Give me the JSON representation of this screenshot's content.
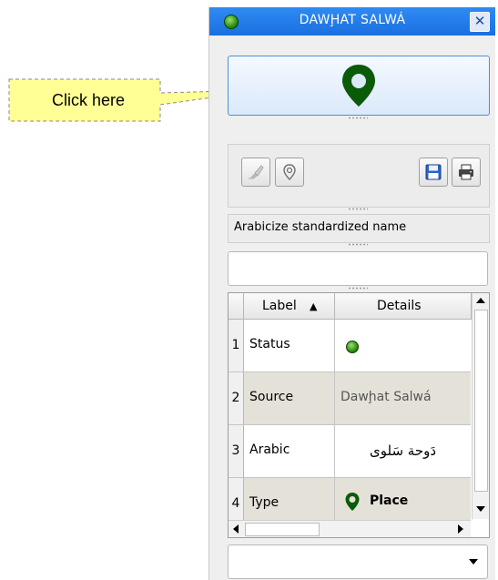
{
  "callout": {
    "text": "Click here"
  },
  "window": {
    "title": "DAWḨAT SALWÁ",
    "close_label": "✕",
    "status_color": "#2f8f12"
  },
  "toolbar": {
    "buttons": [
      "brush-icon",
      "pin-outline-icon",
      "save-icon",
      "print-icon"
    ]
  },
  "name_field": {
    "label": "Arabicize standardized name"
  },
  "text_field": {
    "value": ""
  },
  "table": {
    "columns": [
      "Label",
      "Details"
    ],
    "sort_indicator": "▲",
    "rows": [
      {
        "num": "1",
        "label": "Status",
        "detail": ""
      },
      {
        "num": "2",
        "label": "Source",
        "detail": "Dawḩat Salwá"
      },
      {
        "num": "3",
        "label": "Arabic",
        "detail": "دَوحة سَلوى"
      },
      {
        "num": "4",
        "label": "Type",
        "detail": "Place"
      }
    ]
  },
  "dropdown": {
    "value": ""
  },
  "colors": {
    "accent": "#1a6fe0",
    "pin": "#0a5a0a",
    "alt_row": "#e4e1d8"
  }
}
